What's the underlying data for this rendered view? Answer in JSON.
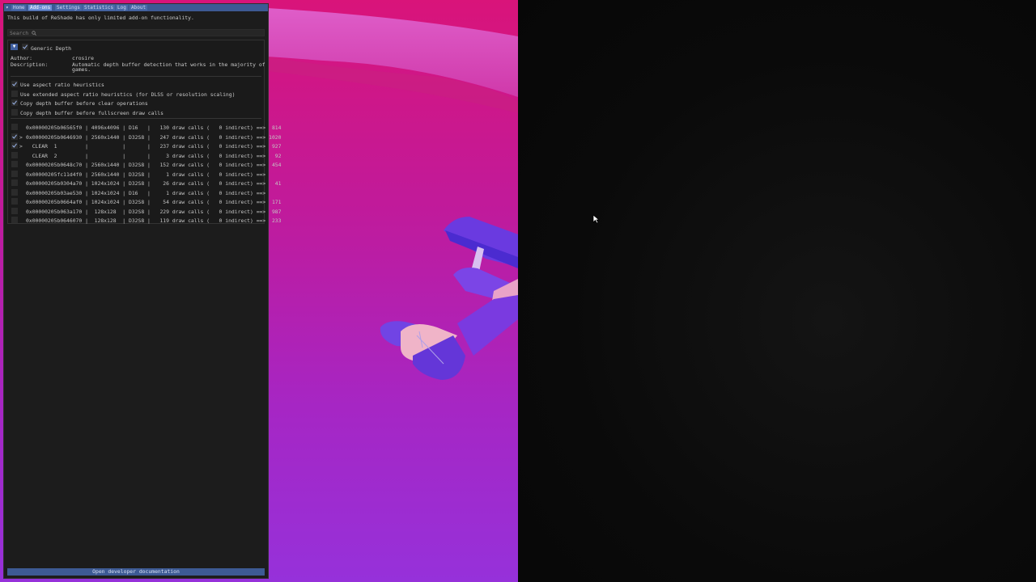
{
  "tabs": [
    "Home",
    "Add-ons",
    "Settings",
    "Statistics",
    "Log",
    "About"
  ],
  "active_tab": "Add-ons",
  "notice": "This build of ReShade has only limited add-on functionality.",
  "search": {
    "placeholder": "Search"
  },
  "addon": {
    "name": "Generic Depth",
    "enabled": true,
    "author_label": "Author:",
    "author": "crosire",
    "description_label": "Description:",
    "description_line1": "Automatic depth buffer detection that works in the majority of",
    "description_line2": "games."
  },
  "options": [
    {
      "label": "Use aspect ratio heuristics",
      "checked": true
    },
    {
      "label": "Use extended aspect ratio heuristics (for DLSS or resolution scaling)",
      "checked": false
    },
    {
      "label": "Copy depth buffer before clear operations",
      "checked": true
    },
    {
      "label": "Copy depth buffer before fullscreen draw calls",
      "checked": false
    }
  ],
  "buffers": [
    {
      "checked": false,
      "arrow": "",
      "text": "0x00000205b06565f0 | 4096x4096 | D16   |   130 draw calls (   0 indirect) ==>  814"
    },
    {
      "checked": true,
      "arrow": ">",
      "text": "0x00000205b0646930 | 2560x1440 | D32S8 |   247 draw calls (   0 indirect) ==> 1020"
    },
    {
      "checked": true,
      "arrow": ">",
      "text": "  CLEAR  1         |           |       |   237 draw calls (   0 indirect) ==>  927"
    },
    {
      "checked": false,
      "arrow": "",
      "text": "  CLEAR  2         |           |       |     3 draw calls (   0 indirect) ==>   92"
    },
    {
      "checked": false,
      "arrow": "",
      "text": "0x00000205b0648c70 | 2560x1440 | D32S8 |   152 draw calls (   0 indirect) ==>  454"
    },
    {
      "checked": false,
      "arrow": "",
      "text": "0x00000205fc11d4f0 | 2560x1440 | D32S8 |     1 draw calls (   0 indirect) ==>"
    },
    {
      "checked": false,
      "arrow": "",
      "text": "0x00000205b0304a70 | 1024x1024 | D32S8 |    26 draw calls (   0 indirect) ==>   41"
    },
    {
      "checked": false,
      "arrow": "",
      "text": "0x00000205b03ae530 | 1024x1024 | D16   |     1 draw calls (   0 indirect) ==>"
    },
    {
      "checked": false,
      "arrow": "",
      "text": "0x00000205b0664af0 | 1024x1024 | D32S8 |    54 draw calls (   0 indirect) ==>  171"
    },
    {
      "checked": false,
      "arrow": "",
      "text": "0x00000205b063a170 |  128x128  | D32S8 |   229 draw calls (   0 indirect) ==>  987"
    },
    {
      "checked": false,
      "arrow": "",
      "text": "0x00000205b0646070 |  128x128  | D32S8 |   119 draw calls (   0 indirect) ==>  233"
    }
  ],
  "footer_button": "Open developer documentation",
  "colors": {
    "accent": "#3d5a94",
    "active_tab": "#6c8fd4",
    "scene_top": "#d9147a",
    "scene_bottom": "#9631da"
  }
}
